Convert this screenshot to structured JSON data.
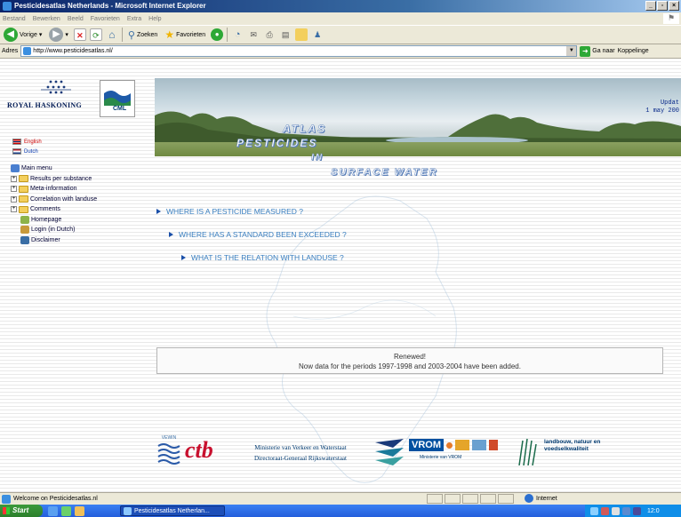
{
  "window": {
    "title": "Pesticidesatlas Netherlands - Microsoft Internet Explorer",
    "controls": [
      "_",
      "▫",
      "×"
    ]
  },
  "menu": [
    "Bestand",
    "Bewerken",
    "Beeld",
    "Favorieten",
    "Extra",
    "Help"
  ],
  "toolbar": {
    "back_label": "Vorige",
    "search_label": "Zoeken",
    "favorites_label": "Favorieten"
  },
  "address": {
    "label": "Adres",
    "url": "http://www.pesticidesatlas.nl/",
    "go_label": "Ga naar",
    "links_label": "Koppelinge"
  },
  "sidebar": {
    "royal_haskoning": "ROYAL HASKONING",
    "cml": "CML",
    "languages": [
      {
        "label": "English",
        "flag": "uk-flag-icon"
      },
      {
        "label": "Dutch",
        "flag": "nl-flag-icon"
      }
    ],
    "main_menu": "Main menu",
    "tree": [
      {
        "label": "Results per substance",
        "type": "folder"
      },
      {
        "label": "Meta-information",
        "type": "folder"
      },
      {
        "label": "Correlation with landuse",
        "type": "folder"
      },
      {
        "label": "Comments",
        "type": "folder"
      },
      {
        "label": "Homepage",
        "type": "page"
      },
      {
        "label": "Login (in Dutch)",
        "type": "login"
      },
      {
        "label": "Disclaimer",
        "type": "info"
      }
    ]
  },
  "banner": {
    "update_label": "Updat",
    "update_date": "1 may 200",
    "title_words": [
      "ATLAS",
      "PESTICIDES",
      "IN",
      "SURFACE WATER"
    ]
  },
  "questions": [
    "WHERE IS A PESTICIDE MEASURED ?",
    "WHERE HAS A STANDARD BEEN EXCEEDED ?",
    "WHAT IS THE RELATION WITH LANDUSE ?"
  ],
  "notice": {
    "title": "Renewed!",
    "text": "Now data for the periods 1997-1998 and 2003-2004 have been added."
  },
  "sponsors": {
    "vewin": "VEWIN",
    "ctb": "ctb",
    "vw_line1": "Ministerie van Verkeer en Waterstaat",
    "vw_line2": "Directoraat-Generaal Rijkswaterstaat",
    "vrom": "VROM",
    "vrom_sub": "Ministerie van VROM",
    "lnv_line1": "landbouw, natuur en",
    "lnv_line2": "voedselkwaliteit"
  },
  "status": {
    "text": "Welcome on Pesticidesatlas.nl",
    "zone": "Internet"
  },
  "taskbar": {
    "start": "Start",
    "task": "Pesticidesatlas Netherlan...",
    "clock": "12:0"
  },
  "colors": {
    "link_blue": "#3a7fc0",
    "arrow_blue": "#1a4fa8",
    "ctb_red": "#c8102e",
    "vrom_blue": "#0050a0"
  }
}
